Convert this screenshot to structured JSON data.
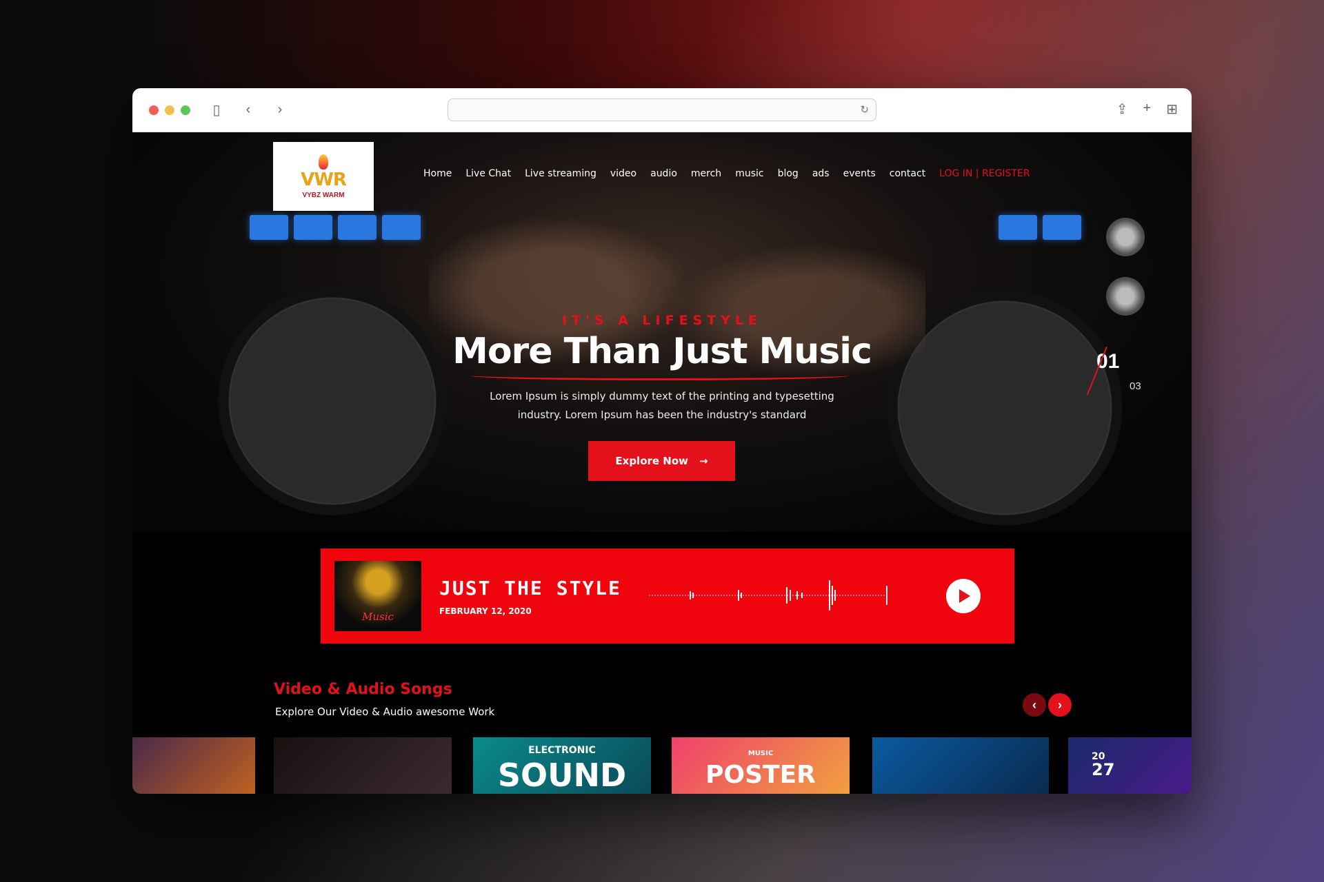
{
  "site": {
    "logo_mark": "VWR",
    "logo_text": "VYBZ WARM"
  },
  "nav": {
    "items": [
      "Home",
      "Live Chat",
      "Live streaming",
      "video",
      "audio",
      "merch",
      "music",
      "blog",
      "ads",
      "events",
      "contact"
    ],
    "login": "LOG IN | REGISTER"
  },
  "hero": {
    "tagline": "IT'S A LIFESTYLE",
    "title": "More Than Just Music",
    "description": "Lorem Ipsum is simply dummy text of the printing and typesetting industry. Lorem Ipsum has been the industry's standard",
    "cta_label": "Explore Now",
    "slide_current": "01",
    "slide_total": "03"
  },
  "player": {
    "cover_text": "Music",
    "track_title": "JUST THE STYLE",
    "track_date": "FEBRUARY 12, 2020"
  },
  "section": {
    "title": "Video & Audio Songs",
    "subtitle": "Explore Our Video & Audio awesome Work"
  },
  "cards": [
    {
      "label": "",
      "color_a": "#4a2a4a",
      "color_b": "#c06020"
    },
    {
      "label": "",
      "color_a": "#1a1010",
      "color_b": "#3a2a30"
    },
    {
      "label": "SOUND",
      "sublabel": "ELECTRONIC",
      "color_a": "#0a8a8a",
      "color_b": "#0a4a5a"
    },
    {
      "label": "POSTER",
      "sublabel": "MUSIC",
      "color_a": "#f0406a",
      "color_b": "#f0a040"
    },
    {
      "label": "",
      "color_a": "#0a5aa0",
      "color_b": "#0a2a50"
    },
    {
      "label": "27",
      "sublabel": "20",
      "color_a": "#1a2a6a",
      "color_b": "#4a1a8a"
    }
  ],
  "colors": {
    "accent": "#e4101a"
  }
}
